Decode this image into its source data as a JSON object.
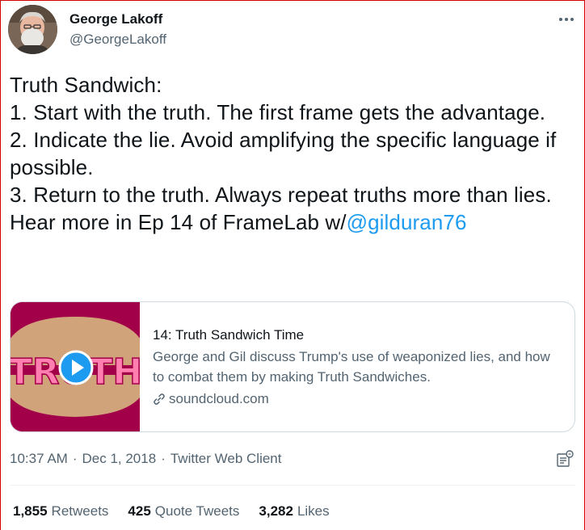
{
  "author": {
    "name": "George Lakoff",
    "handle": "@GeorgeLakoff"
  },
  "tweet": {
    "text": "Truth Sandwich:\n1. Start with the truth. The first frame gets the advantage.\n2. Indicate the lie. Avoid amplifying the specific language if possible.\n3. Return to the truth. Always repeat truths more than lies.\nHear more in Ep 14 of FrameLab w/",
    "mention": "@gilduran76"
  },
  "card": {
    "thumbnail_text": "TRUTH",
    "title": "14: Truth Sandwich Time",
    "description": "George and Gil discuss Trump's use of weaponized lies, and how to combat them by making Truth Sandwiches.",
    "domain": "soundcloud.com"
  },
  "meta": {
    "time": "10:37 AM",
    "date": "Dec 1, 2018",
    "client": "Twitter Web Client",
    "separator": "·"
  },
  "stats": {
    "retweets_count": "1,855",
    "retweets_label": "Retweets",
    "quotes_count": "425",
    "quotes_label": "Quote Tweets",
    "likes_count": "3,282",
    "likes_label": "Likes"
  },
  "colors": {
    "link": "#1d9bf0",
    "secondary_text": "#536471",
    "thumb_background": "#a3004a",
    "bun": "#d1a37a",
    "truth_text": "#ff7fb0",
    "play_button": "#1d9bf0"
  },
  "icons": {
    "more": "more-horizontal-icon",
    "link": "link-icon",
    "analytics": "analytics-icon",
    "play": "play-icon"
  }
}
